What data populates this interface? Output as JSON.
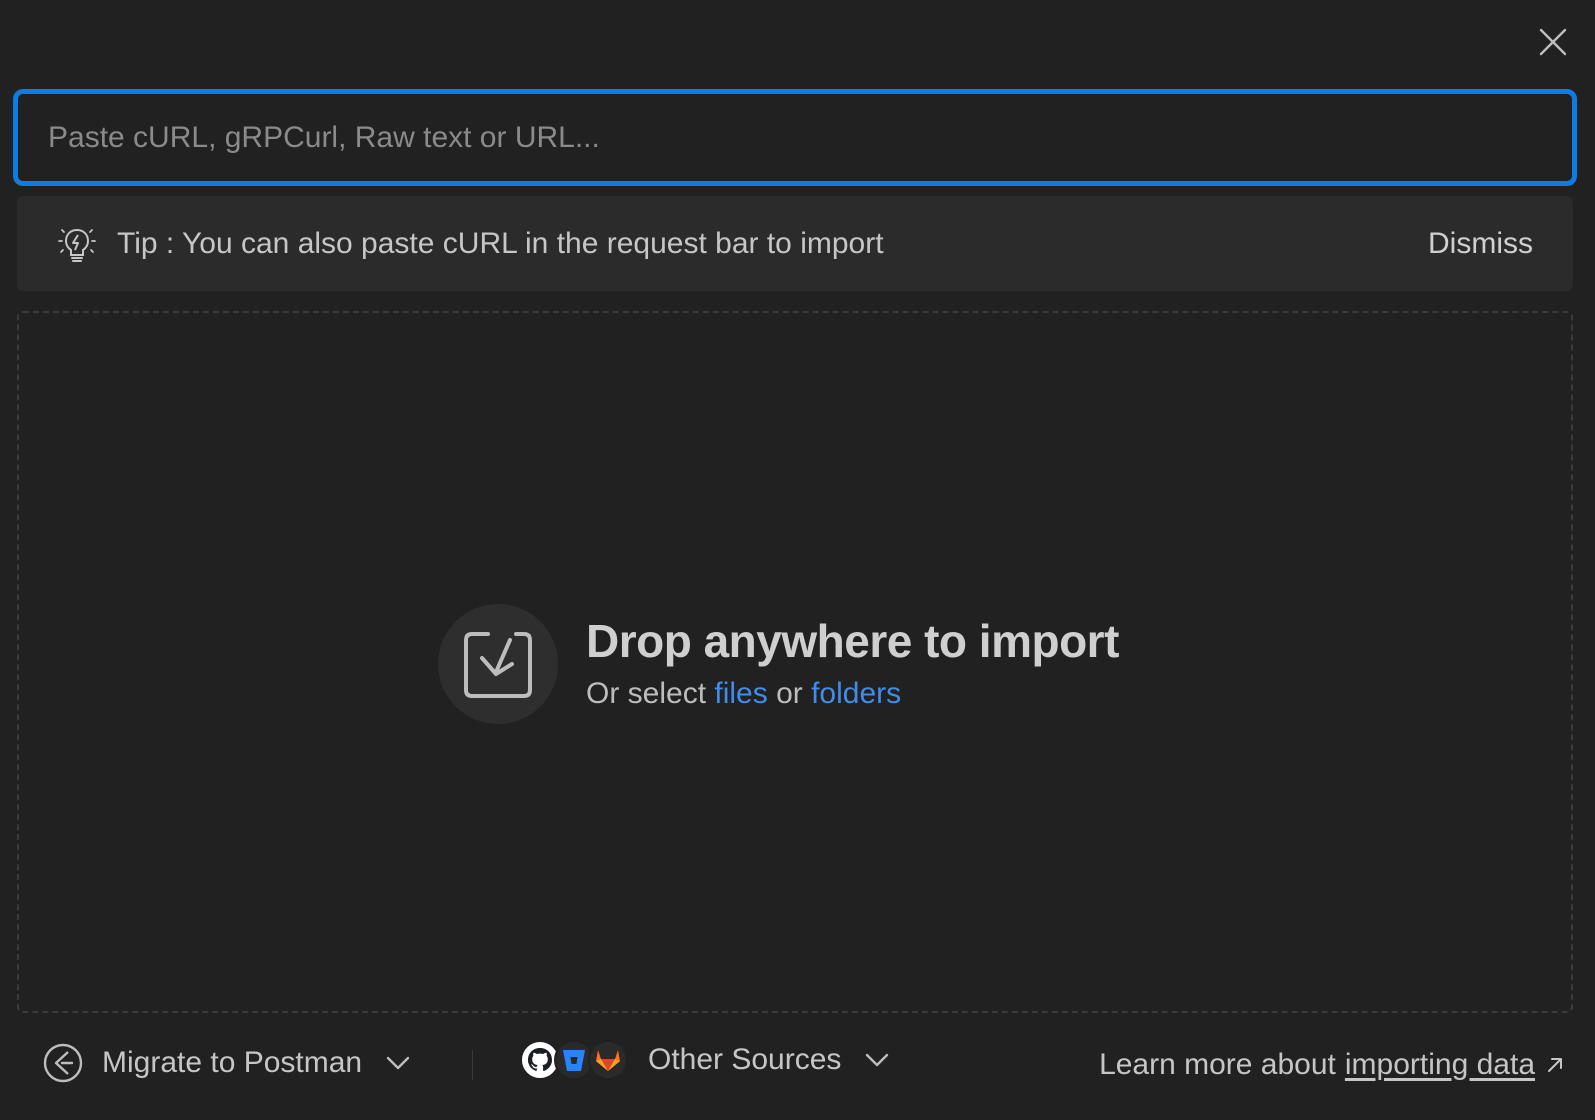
{
  "dialog": {
    "close_icon": "close-icon"
  },
  "import_input": {
    "placeholder": "Paste cURL, gRPCurl, Raw text or URL...",
    "value": "",
    "focus_color": "#0c7ce6"
  },
  "tip": {
    "icon": "lightbulb-icon",
    "text": "Tip : You can also paste cURL in the request bar to import",
    "dismiss_label": "Dismiss"
  },
  "drop_zone": {
    "icon": "import-icon",
    "title": "Drop anywhere to import",
    "subtitle_prefix": "Or select ",
    "files_link": "files",
    "subtitle_mid": " or ",
    "folders_link": "folders",
    "link_color": "#3f8cea"
  },
  "footer": {
    "migrate_label": "Migrate to Postman",
    "other_sources_label": "Other Sources",
    "source_icons": [
      "github-icon",
      "bitbucket-icon",
      "gitlab-icon"
    ],
    "learn_prefix": "Learn more about",
    "learn_link": "importing data"
  }
}
